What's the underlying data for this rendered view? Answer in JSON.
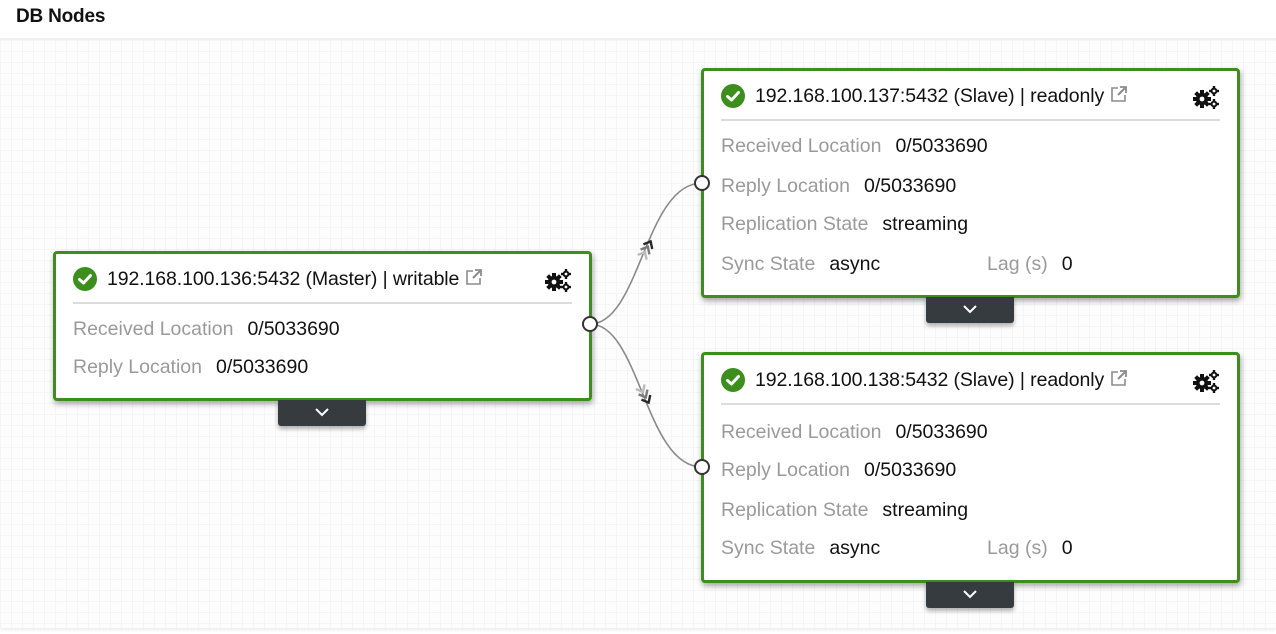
{
  "panel": {
    "title": "DB Nodes"
  },
  "colors": {
    "node_border": "#3d8f1d",
    "status_ok": "#3d8f1d",
    "toggle_bg": "#353b3f",
    "label": "#9a9a9a",
    "edge": "#8a8a8a"
  },
  "nodes": [
    {
      "id": "master",
      "status_icon": "check-circle-icon",
      "title": "192.168.100.136:5432 (Master) | writable",
      "role": "Master",
      "access": "writable",
      "fields": [
        {
          "label": "Received Location",
          "value": "0/5033690"
        },
        {
          "label": "Reply Location",
          "value": "0/5033690"
        }
      ],
      "actions": [
        "external-link-icon",
        "gears-icon"
      ],
      "toggle_icon": "chevron-down-icon"
    },
    {
      "id": "slave-137",
      "status_icon": "check-circle-icon",
      "title": "192.168.100.137:5432 (Slave) | readonly",
      "role": "Slave",
      "access": "readonly",
      "fields": [
        {
          "label": "Received Location",
          "value": "0/5033690"
        },
        {
          "label": "Reply Location",
          "value": "0/5033690"
        },
        {
          "label": "Replication State",
          "value": "streaming"
        },
        {
          "label": "Sync State",
          "value": "async"
        }
      ],
      "lag": {
        "label": "Lag (s)",
        "value": "0"
      },
      "actions": [
        "external-link-icon",
        "gears-icon"
      ],
      "toggle_icon": "chevron-down-icon"
    },
    {
      "id": "slave-138",
      "status_icon": "check-circle-icon",
      "title": "192.168.100.138:5432 (Slave) | readonly",
      "role": "Slave",
      "access": "readonly",
      "fields": [
        {
          "label": "Received Location",
          "value": "0/5033690"
        },
        {
          "label": "Reply Location",
          "value": "0/5033690"
        },
        {
          "label": "Replication State",
          "value": "streaming"
        },
        {
          "label": "Sync State",
          "value": "async"
        }
      ],
      "lag": {
        "label": "Lag (s)",
        "value": "0"
      },
      "actions": [
        "external-link-icon",
        "gears-icon"
      ],
      "toggle_icon": "chevron-down-icon"
    }
  ],
  "edges": [
    {
      "from": "master",
      "to": "slave-137",
      "direction": "master-to-slave"
    },
    {
      "from": "master",
      "to": "slave-138",
      "direction": "master-to-slave"
    }
  ]
}
